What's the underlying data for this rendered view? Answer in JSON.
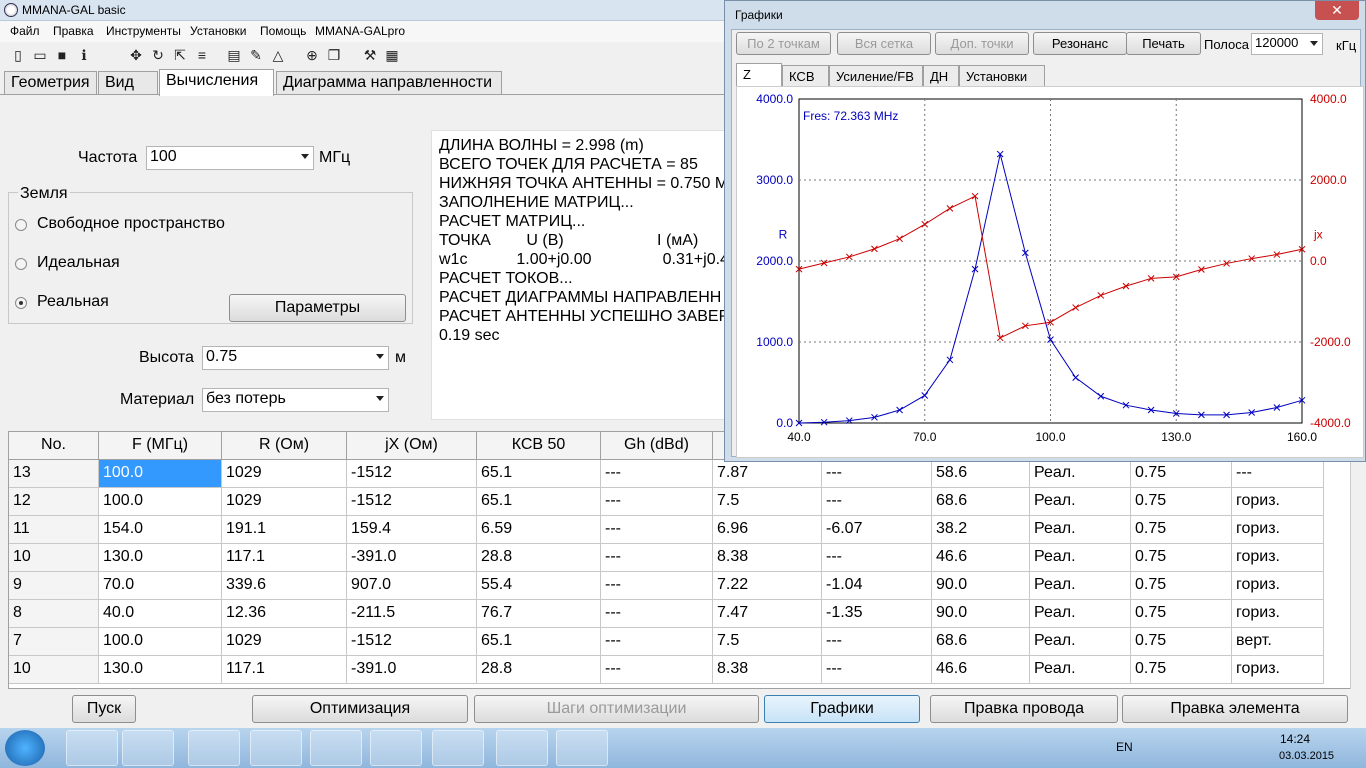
{
  "window": {
    "title": "MMANA-GAL basic"
  },
  "menu": [
    "Файл",
    "Правка",
    "Инструменты",
    "Установки",
    "Помощь",
    "MMANA-GALpro"
  ],
  "tabs": [
    "Геометрия",
    "Вид",
    "Вычисления",
    "Диаграмма направленности"
  ],
  "form": {
    "freq_label": "Частота",
    "freq_value": "100",
    "freq_unit": "МГц",
    "ground_title": "Земля",
    "ground_options": [
      "Свободное пространство",
      "Идеальная",
      "Реальная"
    ],
    "params_button": "Параметры",
    "height_label": "Высота",
    "height_value": "0.75",
    "height_unit": "м",
    "material_label": "Материал",
    "material_value": "без потерь"
  },
  "log": [
    "ДЛИНА ВОЛНЫ = 2.998 (m)",
    "ВСЕГО ТОЧЕК ДЛЯ РАСЧЕТА = 85",
    "НИЖНЯЯ ТОЧКА АНТЕННЫ = 0.750 М",
    "ЗАПОЛНЕНИЕ МАТРИЦ...",
    "РАСЧЕТ МАТРИЦ...",
    "ТОЧКА        U (B)                     I (мА)",
    "w1c           1.00+j0.00                0.31+j0.4",
    "РАСЧЕТ ТОКОВ...",
    "РАСЧЕТ ДИАГРАММЫ НАПРАВЛЕНН",
    "РАСЧЕТ АНТЕННЫ УСПЕШНО ЗАВЕР",
    "0.19 sec"
  ],
  "table": {
    "headers": [
      "No.",
      "F (МГц)",
      "R (Ом)",
      "jX (Ом)",
      "КСВ 50",
      "Gh (dBd)",
      "",
      "",
      "",
      "",
      "",
      ""
    ],
    "rows": [
      [
        "13",
        "100.0",
        "1029",
        "-1512",
        "65.1",
        "---",
        "7.87",
        "---",
        "58.6",
        "Реал.",
        "0.75",
        "---"
      ],
      [
        "12",
        "100.0",
        "1029",
        "-1512",
        "65.1",
        "---",
        "7.5",
        "---",
        "68.6",
        "Реал.",
        "0.75",
        "гориз."
      ],
      [
        "11",
        "154.0",
        "191.1",
        "159.4",
        "6.59",
        "---",
        "6.96",
        "-6.07",
        "38.2",
        "Реал.",
        "0.75",
        "гориз."
      ],
      [
        "10",
        "130.0",
        "117.1",
        "-391.0",
        "28.8",
        "---",
        "8.38",
        "---",
        "46.6",
        "Реал.",
        "0.75",
        "гориз."
      ],
      [
        "9",
        "70.0",
        "339.6",
        "907.0",
        "55.4",
        "---",
        "7.22",
        "-1.04",
        "90.0",
        "Реал.",
        "0.75",
        "гориз."
      ],
      [
        "8",
        "40.0",
        "12.36",
        "-211.5",
        "76.7",
        "---",
        "7.47",
        "-1.35",
        "90.0",
        "Реал.",
        "0.75",
        "гориз."
      ],
      [
        "7",
        "100.0",
        "1029",
        "-1512",
        "65.1",
        "---",
        "7.5",
        "---",
        "68.6",
        "Реал.",
        "0.75",
        "верт."
      ],
      [
        "10",
        "130.0",
        "117.1",
        "-391.0",
        "28.8",
        "---",
        "8.38",
        "---",
        "46.6",
        "Реал.",
        "0.75",
        "гориз."
      ]
    ]
  },
  "bottom_buttons": [
    "Пуск",
    "Оптимизация",
    "Шаги оптимизации",
    "Графики",
    "Правка провода",
    "Правка элемента"
  ],
  "graph_window": {
    "title": "Графики",
    "close": "✕",
    "buttons": [
      "По 2 точкам",
      "Вся сетка",
      "Доп. точки",
      "Резонанс",
      "Печать"
    ],
    "band_label": "Полоса",
    "band_value": "120000",
    "band_unit": "кГц",
    "tabs": [
      "Z",
      "КСВ",
      "Усиление/FB",
      "ДН",
      "Установки"
    ]
  },
  "chart_data": {
    "type": "line",
    "annotation": "Fres: 72.363 MHz",
    "left_axis_label": "R",
    "right_axis_label": "jx",
    "x_ticks": [
      "40.0",
      "70.0",
      "100.0",
      "130.0",
      "160.0"
    ],
    "left_ticks": [
      "4000.0",
      "3000.0",
      "2000.0",
      "1000.0",
      "0.0"
    ],
    "right_ticks": [
      "4000.0",
      "2000.0",
      "0.0",
      "-2000.0",
      "-4000.0"
    ],
    "xlim": [
      40,
      160
    ],
    "left_ylim": [
      0,
      4000
    ],
    "right_ylim": [
      -4000,
      4000
    ],
    "colors": {
      "R": "#0000c0",
      "jX": "#cc0000"
    },
    "series": [
      {
        "name": "R",
        "axis": "left",
        "x": [
          40,
          46,
          52,
          58,
          64,
          70,
          76,
          82,
          88,
          94,
          100,
          106,
          112,
          118,
          124,
          130,
          136,
          142,
          148,
          154,
          160
        ],
        "y": [
          0,
          10,
          30,
          70,
          160,
          340,
          780,
          1900,
          3320,
          2100,
          1029,
          560,
          330,
          220,
          160,
          117,
          100,
          100,
          130,
          191,
          280
        ]
      },
      {
        "name": "jX",
        "axis": "right",
        "x": [
          40,
          46,
          52,
          58,
          64,
          70,
          76,
          82,
          88,
          94,
          100,
          106,
          112,
          118,
          124,
          130,
          136,
          142,
          148,
          154,
          160
        ],
        "y": [
          -200,
          -50,
          100,
          300,
          550,
          907,
          1300,
          1600,
          -1900,
          -1600,
          -1512,
          -1150,
          -850,
          -620,
          -430,
          -391,
          -210,
          -60,
          60,
          159.4,
          290
        ]
      }
    ]
  },
  "taskbar": {
    "lang": "EN",
    "time": "14:24",
    "date": "03.03.2015"
  }
}
